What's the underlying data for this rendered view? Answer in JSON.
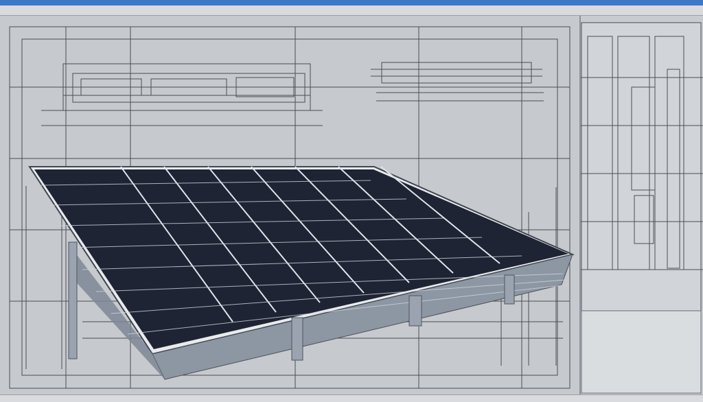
{
  "window": {
    "title": ""
  },
  "toolbar": {
    "items": [
      "",
      "",
      "",
      "",
      ""
    ]
  },
  "status": {
    "left": "",
    "right": ""
  },
  "colors": {
    "titlebar": "#3d78c8",
    "paper": "#c6c9cd",
    "line": "#4a4f57",
    "panel_cell": "#1e2433",
    "frame": "#e8eaee",
    "structure": "#7d8794"
  },
  "icons": [
    "window-titlebar",
    "drawing-canvas",
    "solar-panel-model",
    "side-panel-floorplan"
  ]
}
